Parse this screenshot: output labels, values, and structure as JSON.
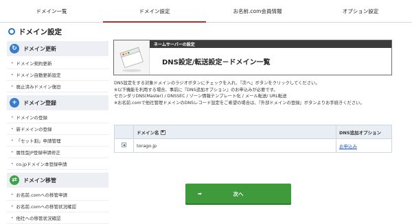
{
  "topnav": {
    "tabs": [
      "ドメイン一覧",
      "ドメイン設定",
      "お名前.com会員情報",
      "オプション設定"
    ]
  },
  "page": {
    "title": "ドメイン設定"
  },
  "sidebar": {
    "groups": [
      {
        "title": "ドメイン更新",
        "items": [
          "ドメイン契約更新",
          "ドメイン自動更新設定",
          "廃止済みドメイン復旧"
        ]
      },
      {
        "title": "ドメイン登録",
        "items": [
          "ドメインの登録",
          "新ドメインの登録",
          "「セット割」申請管理",
          "属性型JP登録申請修正",
          "co.jpドメイン本登録申請"
        ]
      },
      {
        "title": "ドメイン移管",
        "items": [
          "お名前.comへの移管申請",
          "お名前.comへの移管状況確認",
          "他社への移管状況確認"
        ]
      }
    ]
  },
  "header": {
    "section_label": "ネームサーバーの設定",
    "title": "DNS設定/転送設定－ドメイン一覧"
  },
  "description": {
    "lines": [
      "DNS設定をする対象ドメインのラジオボタンにチェックを入れ、『次へ』ボタンをクリックしてください。",
      "※以下機能を利用する場合、事前に『DNS追加オプション』のお申込みが必要です。",
      "セカンダリDNS(Master) / DNSSEC / ゾーン情報テンプレート化 / メール転送/ URL転送",
      "※お名前.comで他社管理ドメインのDNSレコード設定をご希望の場合は、『外部ドメインの登録』ボタンよりお手続きください。"
    ]
  },
  "table": {
    "headers": [
      "",
      "ドメイン名",
      "DNS追加オプション"
    ],
    "rows": [
      {
        "domain": "torago.jp",
        "option": "お申込み"
      }
    ]
  },
  "buttons": {
    "next": "次へ"
  },
  "colors": {
    "accent_red": "#b82a2a",
    "blue": "#2a74bf",
    "green_button": "#3e9a3a",
    "header_strip": "#3b3b3b"
  }
}
